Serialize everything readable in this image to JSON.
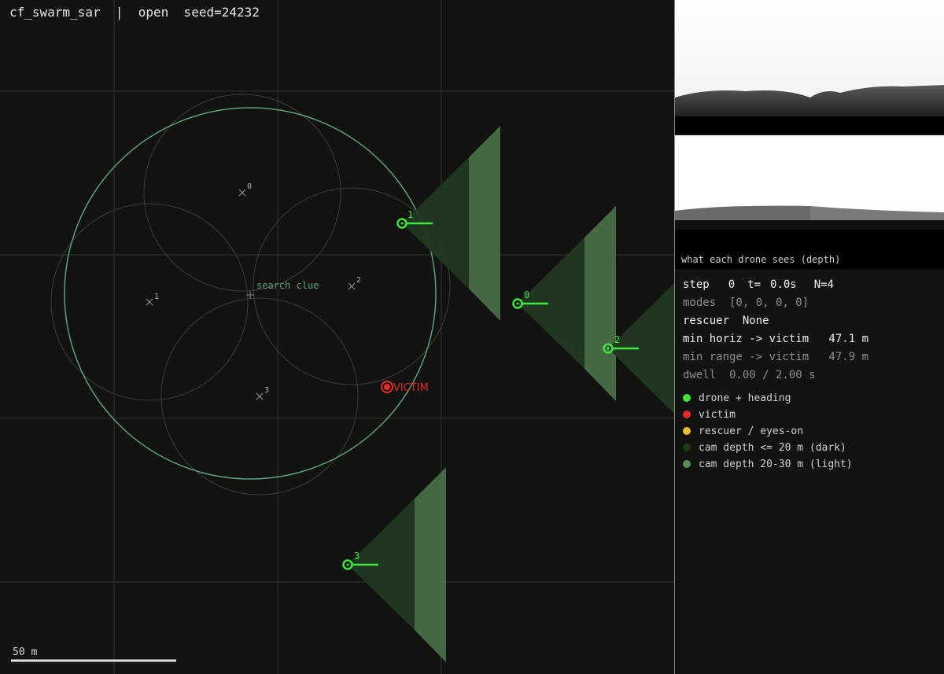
{
  "title": "cf_swarm_sar  |  open  seed=24232",
  "scale_bar": {
    "label": "50 m"
  },
  "map_labels": {
    "search_clue": "search clue",
    "victim": "VICTIM",
    "waypoints": [
      "0",
      "1",
      "2",
      "3"
    ],
    "drones": [
      "1",
      "0",
      "2",
      "3"
    ]
  },
  "camera_panel": {
    "caption": "what each drone sees (depth)"
  },
  "status": {
    "step_label": "step",
    "step_value": "0",
    "t_label": "t=",
    "t_value": "0.0s",
    "n_label": "N=4",
    "modes": "modes  [0, 0, 0, 0]",
    "rescuer": "rescuer  None",
    "min_horiz": "min horiz -> victim   47.1 m",
    "min_range": "min range -> victim   47.9 m",
    "dwell": "dwell  0.00 / 2.00 s"
  },
  "legend": [
    {
      "label": "drone + heading",
      "color": "#3ee63e"
    },
    {
      "label": "victim",
      "color": "#e52a2a"
    },
    {
      "label": "rescuer / eyes-on",
      "color": "#e8c02a"
    },
    {
      "label": "cam depth <= 20 m (dark)",
      "color": "#1e3a1e"
    },
    {
      "label": "cam depth 20-30 m (light)",
      "color": "#5a8a5a"
    }
  ],
  "colors": {
    "drone": "#3ee63e",
    "victim": "#e52a2a",
    "fov_dark": "#2c4a2c",
    "fov_light": "#4e7a4e",
    "search_circle": "#5aa07a",
    "grid": "#3a3a36"
  }
}
